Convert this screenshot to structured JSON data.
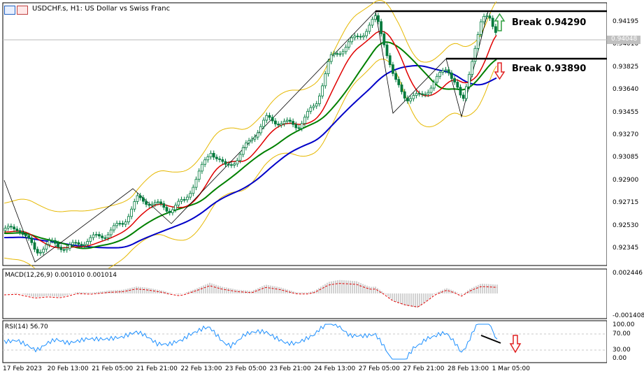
{
  "window": {
    "title": "USDCHF.s, H1:  US Dollar vs Swiss Franc"
  },
  "price_axis": {
    "ticks": [
      "0.94195",
      "0.94010",
      "0.93825",
      "0.93640",
      "0.93455",
      "0.93270",
      "0.93085",
      "0.92900",
      "0.92715",
      "0.92530",
      "0.92345"
    ],
    "current_price": "0.94048"
  },
  "time_axis": {
    "labels": [
      "17 Feb 2023",
      "20 Feb 13:00",
      "21 Feb 05:00",
      "21 Feb 21:00",
      "22 Feb 13:00",
      "23 Feb 05:00",
      "23 Feb 21:00",
      "24 Feb 13:00",
      "27 Feb 05:00",
      "27 Feb 21:00",
      "28 Feb 13:00",
      "1 Mar 05:00"
    ]
  },
  "annotations": {
    "upper": "Break 0.94290",
    "lower": "Break 0.93890"
  },
  "macd": {
    "label": "MACD(12,26,9) 0.001010 0.001014",
    "axis_top": "0.002446",
    "axis_bottom": "-0.001408"
  },
  "rsi": {
    "label": "RSI(14) 56.70",
    "ticks": [
      "100.00",
      "70.00",
      "30.00",
      "0.00"
    ]
  },
  "colors": {
    "candle": "#007a3d",
    "bollinger": "#e6b800",
    "ma_fast": "#e00000",
    "ma_mid": "#008000",
    "ma_slow": "#0000c8",
    "macd_signal": "#e00000",
    "macd_hist": "#b4b4b4",
    "rsi_line": "#1e90ff",
    "arrow_up": "#2e9e3e",
    "arrow_down": "#e02020",
    "grid": "#c8c8c8"
  },
  "icons": [
    "bars-icon",
    "candles-icon"
  ]
}
